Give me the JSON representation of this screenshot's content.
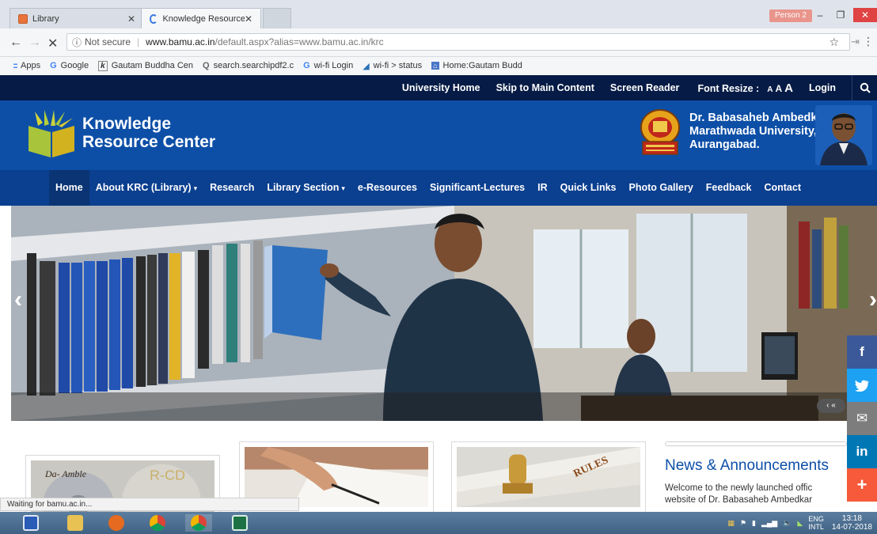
{
  "browser": {
    "tabs": [
      {
        "title": "Library"
      },
      {
        "title": "Knowledge Resource Cen"
      }
    ],
    "profile": "Person 2",
    "omnibox": {
      "security": "Not secure",
      "host": "www.bamu.ac.in",
      "path": "/default.aspx?alias=www.bamu.ac.in/krc"
    },
    "bookmarks": [
      {
        "icon": "apps-icon",
        "glyph": ":::",
        "label": "Apps"
      },
      {
        "icon": "google-icon",
        "glyph": "G",
        "label": "Google"
      },
      {
        "icon": "k-icon",
        "glyph": "k",
        "label": "Gautam Buddha Cen"
      },
      {
        "icon": "search-icon",
        "glyph": "Q",
        "label": "search.searchipdf2.c"
      },
      {
        "icon": "google-icon",
        "glyph": "G",
        "label": "wi-fi Login"
      },
      {
        "icon": "wifi-icon",
        "glyph": "◢",
        "label": "wi-fi > status"
      },
      {
        "icon": "home-icon",
        "glyph": "⌂",
        "label": "Home:Gautam Budd"
      }
    ],
    "status": "Waiting for bamu.ac.in..."
  },
  "topbar": {
    "links": [
      "University Home",
      "Skip to Main Content",
      "Screen Reader"
    ],
    "font_resize_label": "Font Resize :",
    "font_sizes": [
      "A",
      "A",
      "A"
    ],
    "login": "Login"
  },
  "header": {
    "logo_line1": "Knowledge",
    "logo_line2": "Resource Center",
    "university_line1": "Dr. Babasaheb Ambedkar",
    "university_line2": "Marathwada University,",
    "university_line3": "Aurangabad."
  },
  "nav": {
    "items": [
      {
        "label": "Home",
        "dropdown": false
      },
      {
        "label": "About KRC (Library)",
        "dropdown": true
      },
      {
        "label": "Research",
        "dropdown": false
      },
      {
        "label": "Library Section",
        "dropdown": true
      },
      {
        "label": "e-Resources",
        "dropdown": false
      },
      {
        "label": "Significant-Lectures",
        "dropdown": false
      },
      {
        "label": "IR",
        "dropdown": false
      },
      {
        "label": "Quick Links",
        "dropdown": false
      },
      {
        "label": "Photo Gallery",
        "dropdown": false
      },
      {
        "label": "Feedback",
        "dropdown": false
      },
      {
        "label": "Contact",
        "dropdown": false
      }
    ]
  },
  "hero": {
    "prev": "‹",
    "next": "›",
    "pager": "‹ «"
  },
  "social": [
    "f",
    "t",
    "✉",
    "in",
    "+"
  ],
  "cards": {
    "card1_text": "Da- Amble",
    "card1_text2": "R-CD",
    "card3_text": "RULES"
  },
  "news": {
    "title": "News & Announcements",
    "line1": "Welcome to the newly launched offic",
    "line2": "website of Dr. Babasaheb Ambedkar"
  },
  "taskbar": {
    "lang_top": "ENG",
    "lang_bottom": "INTL",
    "time": "13:18",
    "date": "14-07-2018"
  },
  "colors": {
    "topbar": "#061b45",
    "header": "#0d4fa7",
    "nav": "#0b3f8f",
    "facebook": "#3b5998",
    "twitter": "#1da1f2",
    "linkedin": "#0077b5",
    "plus": "#f65a3a"
  }
}
